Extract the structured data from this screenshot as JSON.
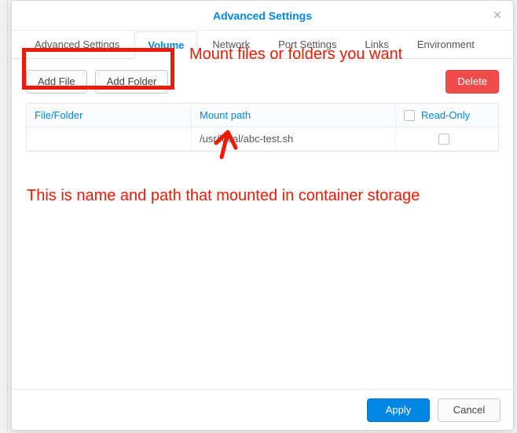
{
  "dialog": {
    "title": "Advanced Settings"
  },
  "tabs": [
    {
      "label": "Advanced Settings"
    },
    {
      "label": "Volume"
    },
    {
      "label": "Network"
    },
    {
      "label": "Port Settings"
    },
    {
      "label": "Links"
    },
    {
      "label": "Environment"
    }
  ],
  "active_tab_index": 1,
  "toolbar": {
    "add_file": "Add File",
    "add_folder": "Add Folder",
    "delete": "Delete"
  },
  "grid": {
    "headers": {
      "file": "File/Folder",
      "mount": "Mount path",
      "readonly": "Read-Only"
    },
    "rows": [
      {
        "file": "",
        "mount": "/usr/local/abc-test.sh",
        "readonly": false
      }
    ]
  },
  "footer": {
    "apply": "Apply",
    "cancel": "Cancel"
  },
  "annotations": {
    "top": "Mount files or folders you want",
    "bottom": "This is name and path that mounted in container storage"
  }
}
